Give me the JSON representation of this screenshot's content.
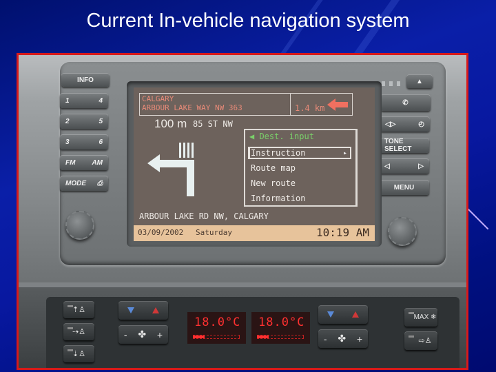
{
  "slide": {
    "title": "Current In-vehicle navigation system"
  },
  "head_unit": {
    "left_buttons": [
      {
        "name": "info",
        "left": "",
        "right": "INFO"
      },
      {
        "name": "preset-1-4",
        "left": "1",
        "right": "4"
      },
      {
        "name": "preset-2-5",
        "left": "2",
        "right": "5"
      },
      {
        "name": "preset-3-6",
        "left": "3",
        "right": "6"
      },
      {
        "name": "fm-am",
        "left": "FM",
        "right": "AM"
      },
      {
        "name": "mode",
        "left": "MODE",
        "right": "⎙"
      }
    ],
    "right_buttons": [
      {
        "name": "eject",
        "label": "▲"
      },
      {
        "name": "phone",
        "label": "✆"
      },
      {
        "name": "seek-clock",
        "left": "◁▷",
        "right": "◴"
      },
      {
        "name": "tone-select",
        "label": "TONE  SELECT"
      },
      {
        "name": "left-right",
        "left": "◁",
        "right": "▷"
      },
      {
        "name": "menu",
        "label": "MENU"
      }
    ]
  },
  "nav_screen": {
    "destination_city": "CALGARY",
    "destination_street": "ARBOUR LAKE WAY NW 363",
    "distance_to_destination": "1.4 km",
    "next_turn_distance": "100 m",
    "next_street": "85 ST NW",
    "menu": {
      "title": "Dest. input",
      "items": [
        {
          "label": "Instruction",
          "selected": true
        },
        {
          "label": "Route map",
          "selected": false
        },
        {
          "label": "New route",
          "selected": false
        },
        {
          "label": "Information",
          "selected": false
        }
      ]
    },
    "current_location": "ARBOUR LAKE RD NW, CALGARY",
    "date": "03/09/2002",
    "weekday": "Saturday",
    "time": "10:19 AM"
  },
  "climate": {
    "left_temp": "18.0°C",
    "right_temp": "18.0°C",
    "left_fan_level": 0.25,
    "right_fan_level": 0.25,
    "fan_minus": "-",
    "fan_plus": "+",
    "max_label": "MAX ❄",
    "colors": {
      "lcd": "#ff3030",
      "temp_down": "#5a8ad8",
      "temp_up": "#d03838"
    }
  }
}
